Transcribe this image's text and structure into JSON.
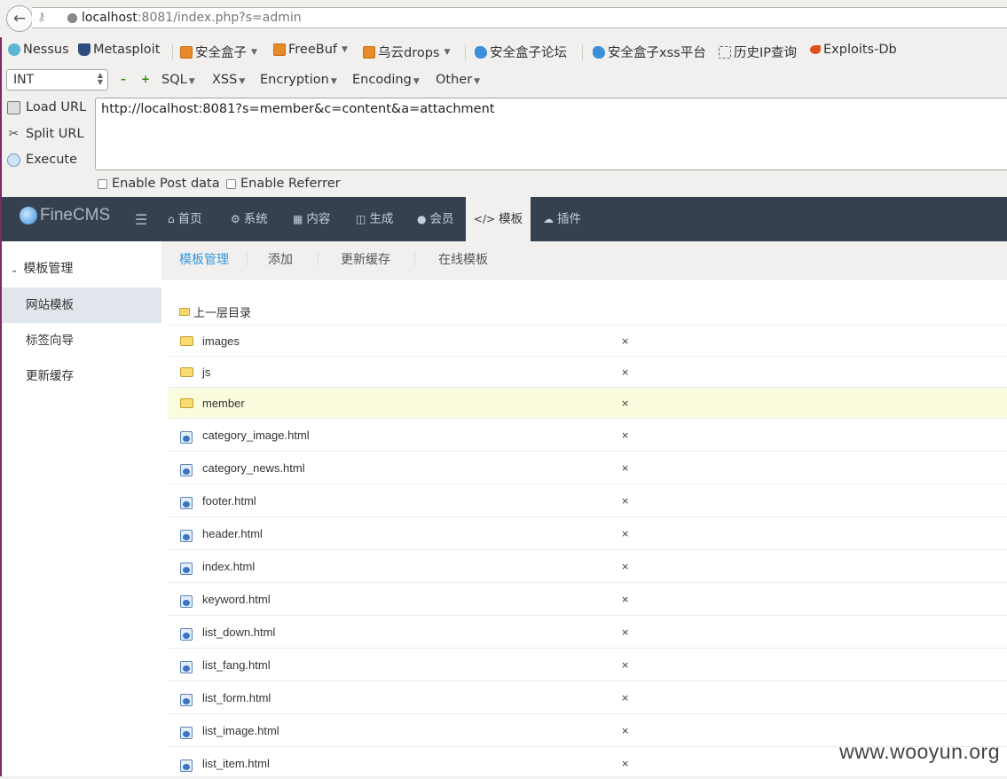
{
  "browser": {
    "url_host": "localhost",
    "url_rest": ":8081/index.php?s=admin"
  },
  "bookmarks": [
    {
      "label": "Nessus",
      "icon": "nessus-icon",
      "dropdown": false
    },
    {
      "label": "Metasploit",
      "icon": "metasploit-icon",
      "dropdown": false
    },
    {
      "label": "安全盒子",
      "icon": "rss-icon",
      "dropdown": true
    },
    {
      "label": "FreeBuf",
      "icon": "rss-icon",
      "dropdown": true
    },
    {
      "label": "乌云drops",
      "icon": "rss-icon",
      "dropdown": true
    },
    {
      "label": "安全盒子论坛",
      "icon": "bird-icon",
      "dropdown": false
    },
    {
      "label": "安全盒子xss平台",
      "icon": "bird-icon",
      "dropdown": false
    },
    {
      "label": "历史IP查询",
      "icon": "dashed-box-icon",
      "dropdown": false
    },
    {
      "label": "Exploits-Db",
      "icon": "exploit-icon",
      "dropdown": false
    }
  ],
  "hackbar": {
    "type_select": "INT",
    "menus": [
      "SQL",
      "XSS",
      "Encryption",
      "Encoding",
      "Other"
    ],
    "load_url": "Load URL",
    "split_url": "Split URL",
    "execute": "Execute",
    "url_value": "http://localhost:8081?s=member&c=content&a=attachment",
    "enable_post": "Enable Post data",
    "enable_referrer": "Enable Referrer"
  },
  "cms": {
    "logo": "FineCMS",
    "nav": [
      {
        "label": "首页",
        "icon": "home-icon",
        "active": false
      },
      {
        "label": "系统",
        "icon": "gear-icon",
        "active": false
      },
      {
        "label": "内容",
        "icon": "table-icon",
        "active": false
      },
      {
        "label": "生成",
        "icon": "trash-icon",
        "active": false
      },
      {
        "label": "会员",
        "icon": "user-icon",
        "active": false
      },
      {
        "label": "模板",
        "icon": "code-icon",
        "active": true
      },
      {
        "label": "插件",
        "icon": "cloud-icon",
        "active": false
      }
    ],
    "sidebar": {
      "heading": "模板管理",
      "items": [
        {
          "label": "网站模板",
          "active": true
        },
        {
          "label": "标签向导",
          "active": false
        },
        {
          "label": "更新缓存",
          "active": false
        }
      ]
    },
    "tabs": [
      {
        "label": "模板管理",
        "active": true
      },
      {
        "label": "添加",
        "active": false
      },
      {
        "label": "更新缓存",
        "active": false
      },
      {
        "label": "在线模板",
        "active": false
      }
    ],
    "parent_dir": "上一层目录",
    "files": [
      {
        "name": "images",
        "type": "folder",
        "highlight": false
      },
      {
        "name": "js",
        "type": "folder",
        "highlight": false
      },
      {
        "name": "member",
        "type": "folder",
        "highlight": true
      },
      {
        "name": "category_image.html",
        "type": "file",
        "highlight": false
      },
      {
        "name": "category_news.html",
        "type": "file",
        "highlight": false
      },
      {
        "name": "footer.html",
        "type": "file",
        "highlight": false
      },
      {
        "name": "header.html",
        "type": "file",
        "highlight": false
      },
      {
        "name": "index.html",
        "type": "file",
        "highlight": false
      },
      {
        "name": "keyword.html",
        "type": "file",
        "highlight": false
      },
      {
        "name": "list_down.html",
        "type": "file",
        "highlight": false
      },
      {
        "name": "list_fang.html",
        "type": "file",
        "highlight": false
      },
      {
        "name": "list_form.html",
        "type": "file",
        "highlight": false
      },
      {
        "name": "list_image.html",
        "type": "file",
        "highlight": false
      },
      {
        "name": "list_item.html",
        "type": "file",
        "highlight": false
      }
    ],
    "delete_symbol": "×"
  },
  "watermark": "www.wooyun.org",
  "colors": {
    "cms_header": "#364150",
    "active_tab": "#3598dc",
    "highlight_row": "#fbfcdd"
  }
}
